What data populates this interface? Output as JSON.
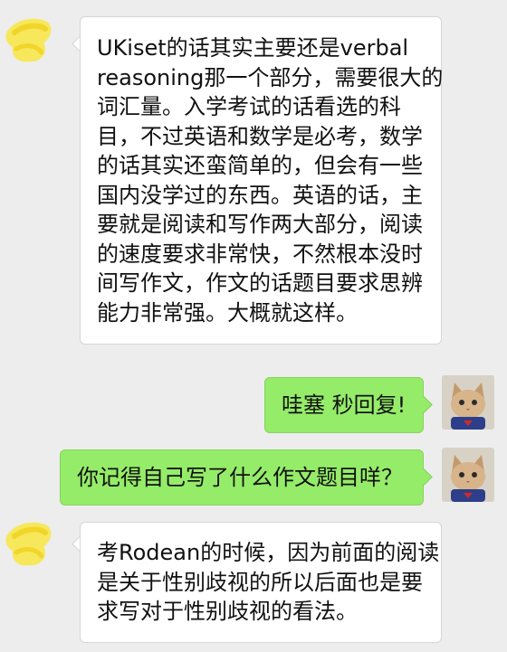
{
  "colors": {
    "background": "#ededed",
    "incoming_bubble": "#ffffff",
    "outgoing_bubble": "#95ec69",
    "avatar_blot": "#f7e64a"
  },
  "messages": [
    {
      "direction": "incoming",
      "avatar_icon": "yellow-blot-avatar-icon",
      "lines": [
        "UKiset的话其实主要还是verbal",
        "reasoning那一个部分，需要很大的",
        "词汇量。入学考试的话看选的科",
        "目，不过英语和数学是必考，数学",
        "的话其实还蛮简单的，但会有一些",
        "国内没学过的东西。英语的话，主",
        "要就是阅读和写作两大部分，阅读",
        "的速度要求非常快，不然根本没时",
        "间写作文，作文的话题目要求思辨",
        "能力非常强。大概就这样。"
      ]
    },
    {
      "direction": "outgoing",
      "avatar_icon": "cat-avatar-icon",
      "lines": [
        "哇塞  秒回复!"
      ]
    },
    {
      "direction": "outgoing",
      "avatar_icon": "cat-avatar-icon",
      "lines": [
        "你记得自己写了什么作文题目咩？"
      ]
    },
    {
      "direction": "incoming",
      "avatar_icon": "yellow-blot-avatar-icon",
      "lines": [
        "考Rodean的时候，因为前面的阅读",
        "是关于性别歧视的所以后面也是要",
        "求写对于性别歧视的看法。"
      ]
    }
  ]
}
